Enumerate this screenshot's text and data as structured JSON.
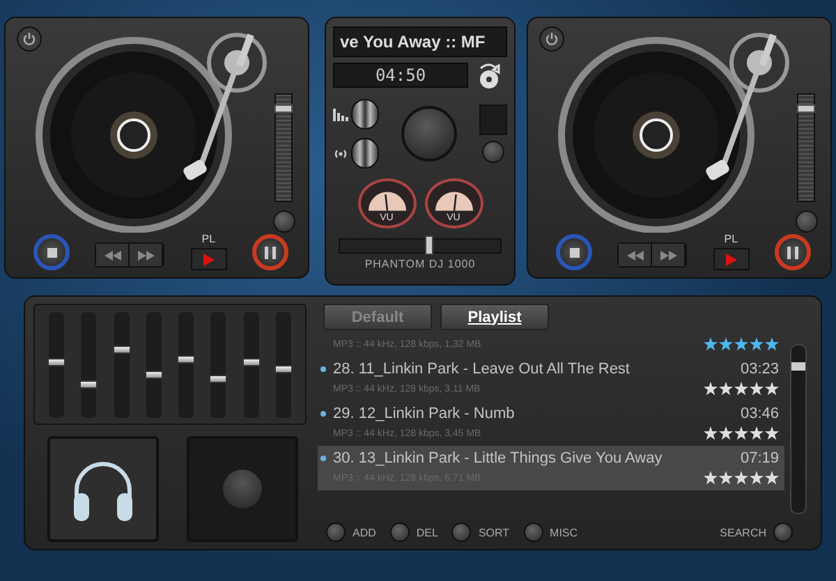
{
  "decks": [
    {
      "pl_label": "PL",
      "pitch": {
        "level": 0.93
      }
    },
    {
      "pl_label": "PL",
      "pitch": {
        "level": 0.93
      }
    }
  ],
  "mixer": {
    "track_title": "ve You Away :: MF",
    "time": "04:50",
    "vu_meters": [
      {
        "label": "VU",
        "level": 0.45
      },
      {
        "label": "VU",
        "level": 0.55
      }
    ],
    "crossfader": {
      "level": 0.55
    },
    "brand": "PHANTOM DJ 1000"
  },
  "equalizer": [
    {
      "level": 0.52
    },
    {
      "level": 0.29
    },
    {
      "level": 0.65
    },
    {
      "level": 0.39
    },
    {
      "level": 0.55
    },
    {
      "level": 0.35
    },
    {
      "level": 0.52
    },
    {
      "level": 0.45
    }
  ],
  "playlist": {
    "tabs": [
      {
        "label": "Default",
        "selected": false
      },
      {
        "label": "Playlist",
        "selected": true
      }
    ],
    "rows": [
      {
        "meta": "MP3 :: 44 kHz, 128 kbps, 1,32 MB",
        "stars": 5,
        "color": "#4fb6ee",
        "selected": false
      },
      {
        "title": "28. 11_Linkin Park - Leave Out All The Rest",
        "time": "03:23",
        "meta": "MP3 :: 44 kHz, 128 kbps, 3,11 MB",
        "stars": 5,
        "color": "#dedede",
        "selected": false
      },
      {
        "title": "29. 12_Linkin Park - Numb",
        "time": "03:46",
        "meta": "MP3 :: 44 kHz, 128 kbps, 3,45 MB",
        "stars": 5,
        "color": "#dedede",
        "selected": false
      },
      {
        "title": "30. 13_Linkin Park - Little Things Give You Away",
        "time": "07:19",
        "meta": "MP3 :: 44 kHz, 128 kbps, 6,71 MB",
        "stars": 5,
        "color": "#dedede",
        "selected": true
      }
    ],
    "buttons": [
      {
        "label": "ADD",
        "kind": "leading"
      },
      {
        "label": "DEL",
        "kind": "leading"
      },
      {
        "label": "SORT",
        "kind": "leading"
      },
      {
        "label": "MISC",
        "kind": "leading"
      },
      {
        "label": "SEARCH",
        "kind": "trailing"
      }
    ]
  }
}
